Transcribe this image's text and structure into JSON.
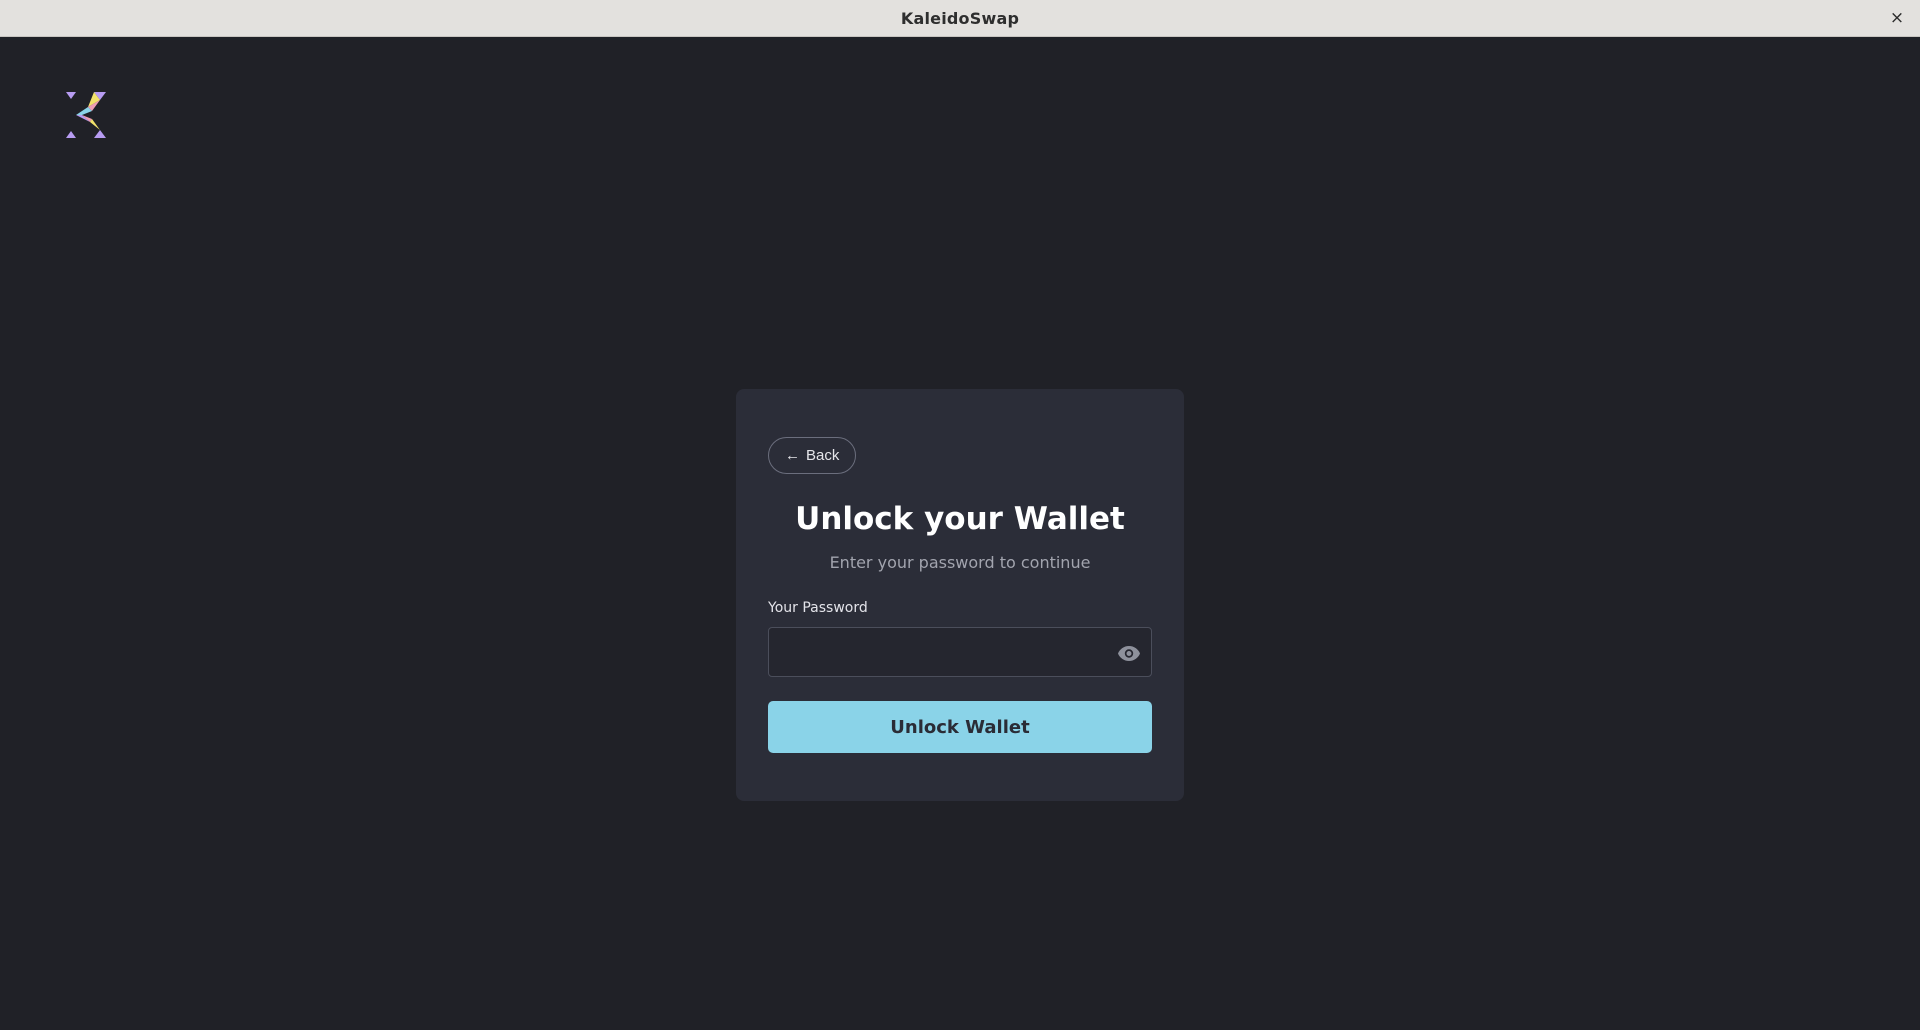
{
  "window": {
    "title": "KaleidoSwap",
    "close_glyph": "×"
  },
  "logo": {
    "icon": "kaleidoswap-logo"
  },
  "card": {
    "back_arrow": "←",
    "back_label": "Back",
    "title": "Unlock your Wallet",
    "subtitle": "Enter your password to continue",
    "password_label": "Your Password",
    "password_value": "",
    "password_placeholder": "",
    "toggle_icon": "eye-icon",
    "submit_label": "Unlock Wallet"
  },
  "colors": {
    "background": "#202127",
    "card": "#2b2d38",
    "accent": "#8ad3e8",
    "muted_text": "#a2a4ae"
  }
}
